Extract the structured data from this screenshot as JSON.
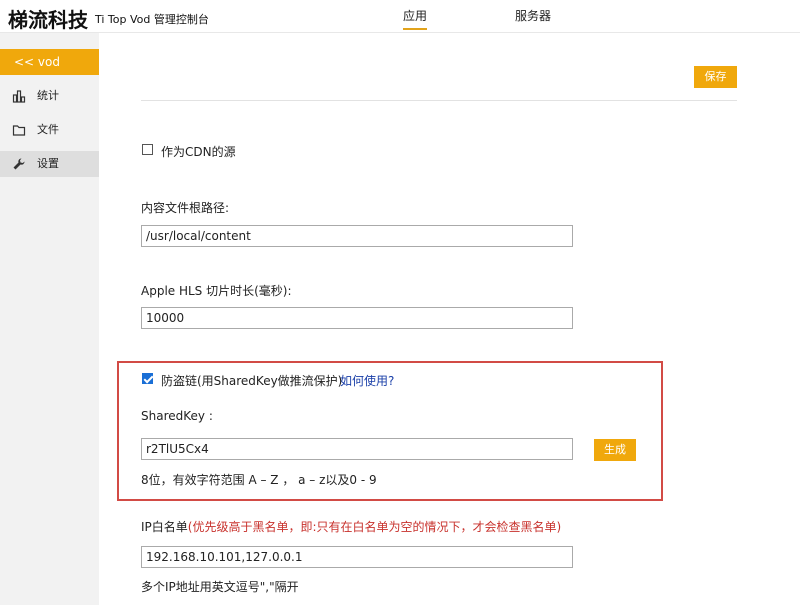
{
  "header": {
    "brand_name": "梯流科技",
    "brand_sub": "Ti Top Vod 管理控制台",
    "tabs": [
      {
        "label": "应用",
        "active": true
      },
      {
        "label": "服务器",
        "active": false
      }
    ]
  },
  "sidebar": {
    "back_label": "<<  vod",
    "items": [
      {
        "label": "统计",
        "icon": "bar-chart-icon"
      },
      {
        "label": "文件",
        "icon": "folder-icon"
      },
      {
        "label": "设置",
        "icon": "wrench-icon",
        "active": true
      }
    ]
  },
  "toolbar": {
    "save_label": "保存"
  },
  "form": {
    "cdn_label": "作为CDN的源",
    "cdn_checked": false,
    "root_path_label": "内容文件根路径:",
    "root_path_value": "/usr/local/content",
    "hls_label": "Apple HLS 切片时长(毫秒):",
    "hls_value": "10000",
    "antileech_label": "防盗链(用SharedKey做推流保护)",
    "antileech_checked": true,
    "howto_link": "如何使用?",
    "sharedkey_label": "SharedKey :",
    "sharedkey_value": "r2TlU5Cx4",
    "generate_label": "生成",
    "sharedkey_hint": "8位，有效字符范围 A – Z ， a – z以及0 - 9",
    "whitelist_label": "IP白名单",
    "whitelist_note": "(优先级高于黑名单，即:只有在白名单为空的情况下，才会检查黑名单)",
    "whitelist_value": "192.168.10.101,127.0.0.1",
    "whitelist_hint": "多个IP地址用英文逗号\",\"隔开"
  },
  "colors": {
    "accent": "#f0a80c",
    "highlight_border": "#d24b45",
    "link": "#1a3fa8"
  }
}
